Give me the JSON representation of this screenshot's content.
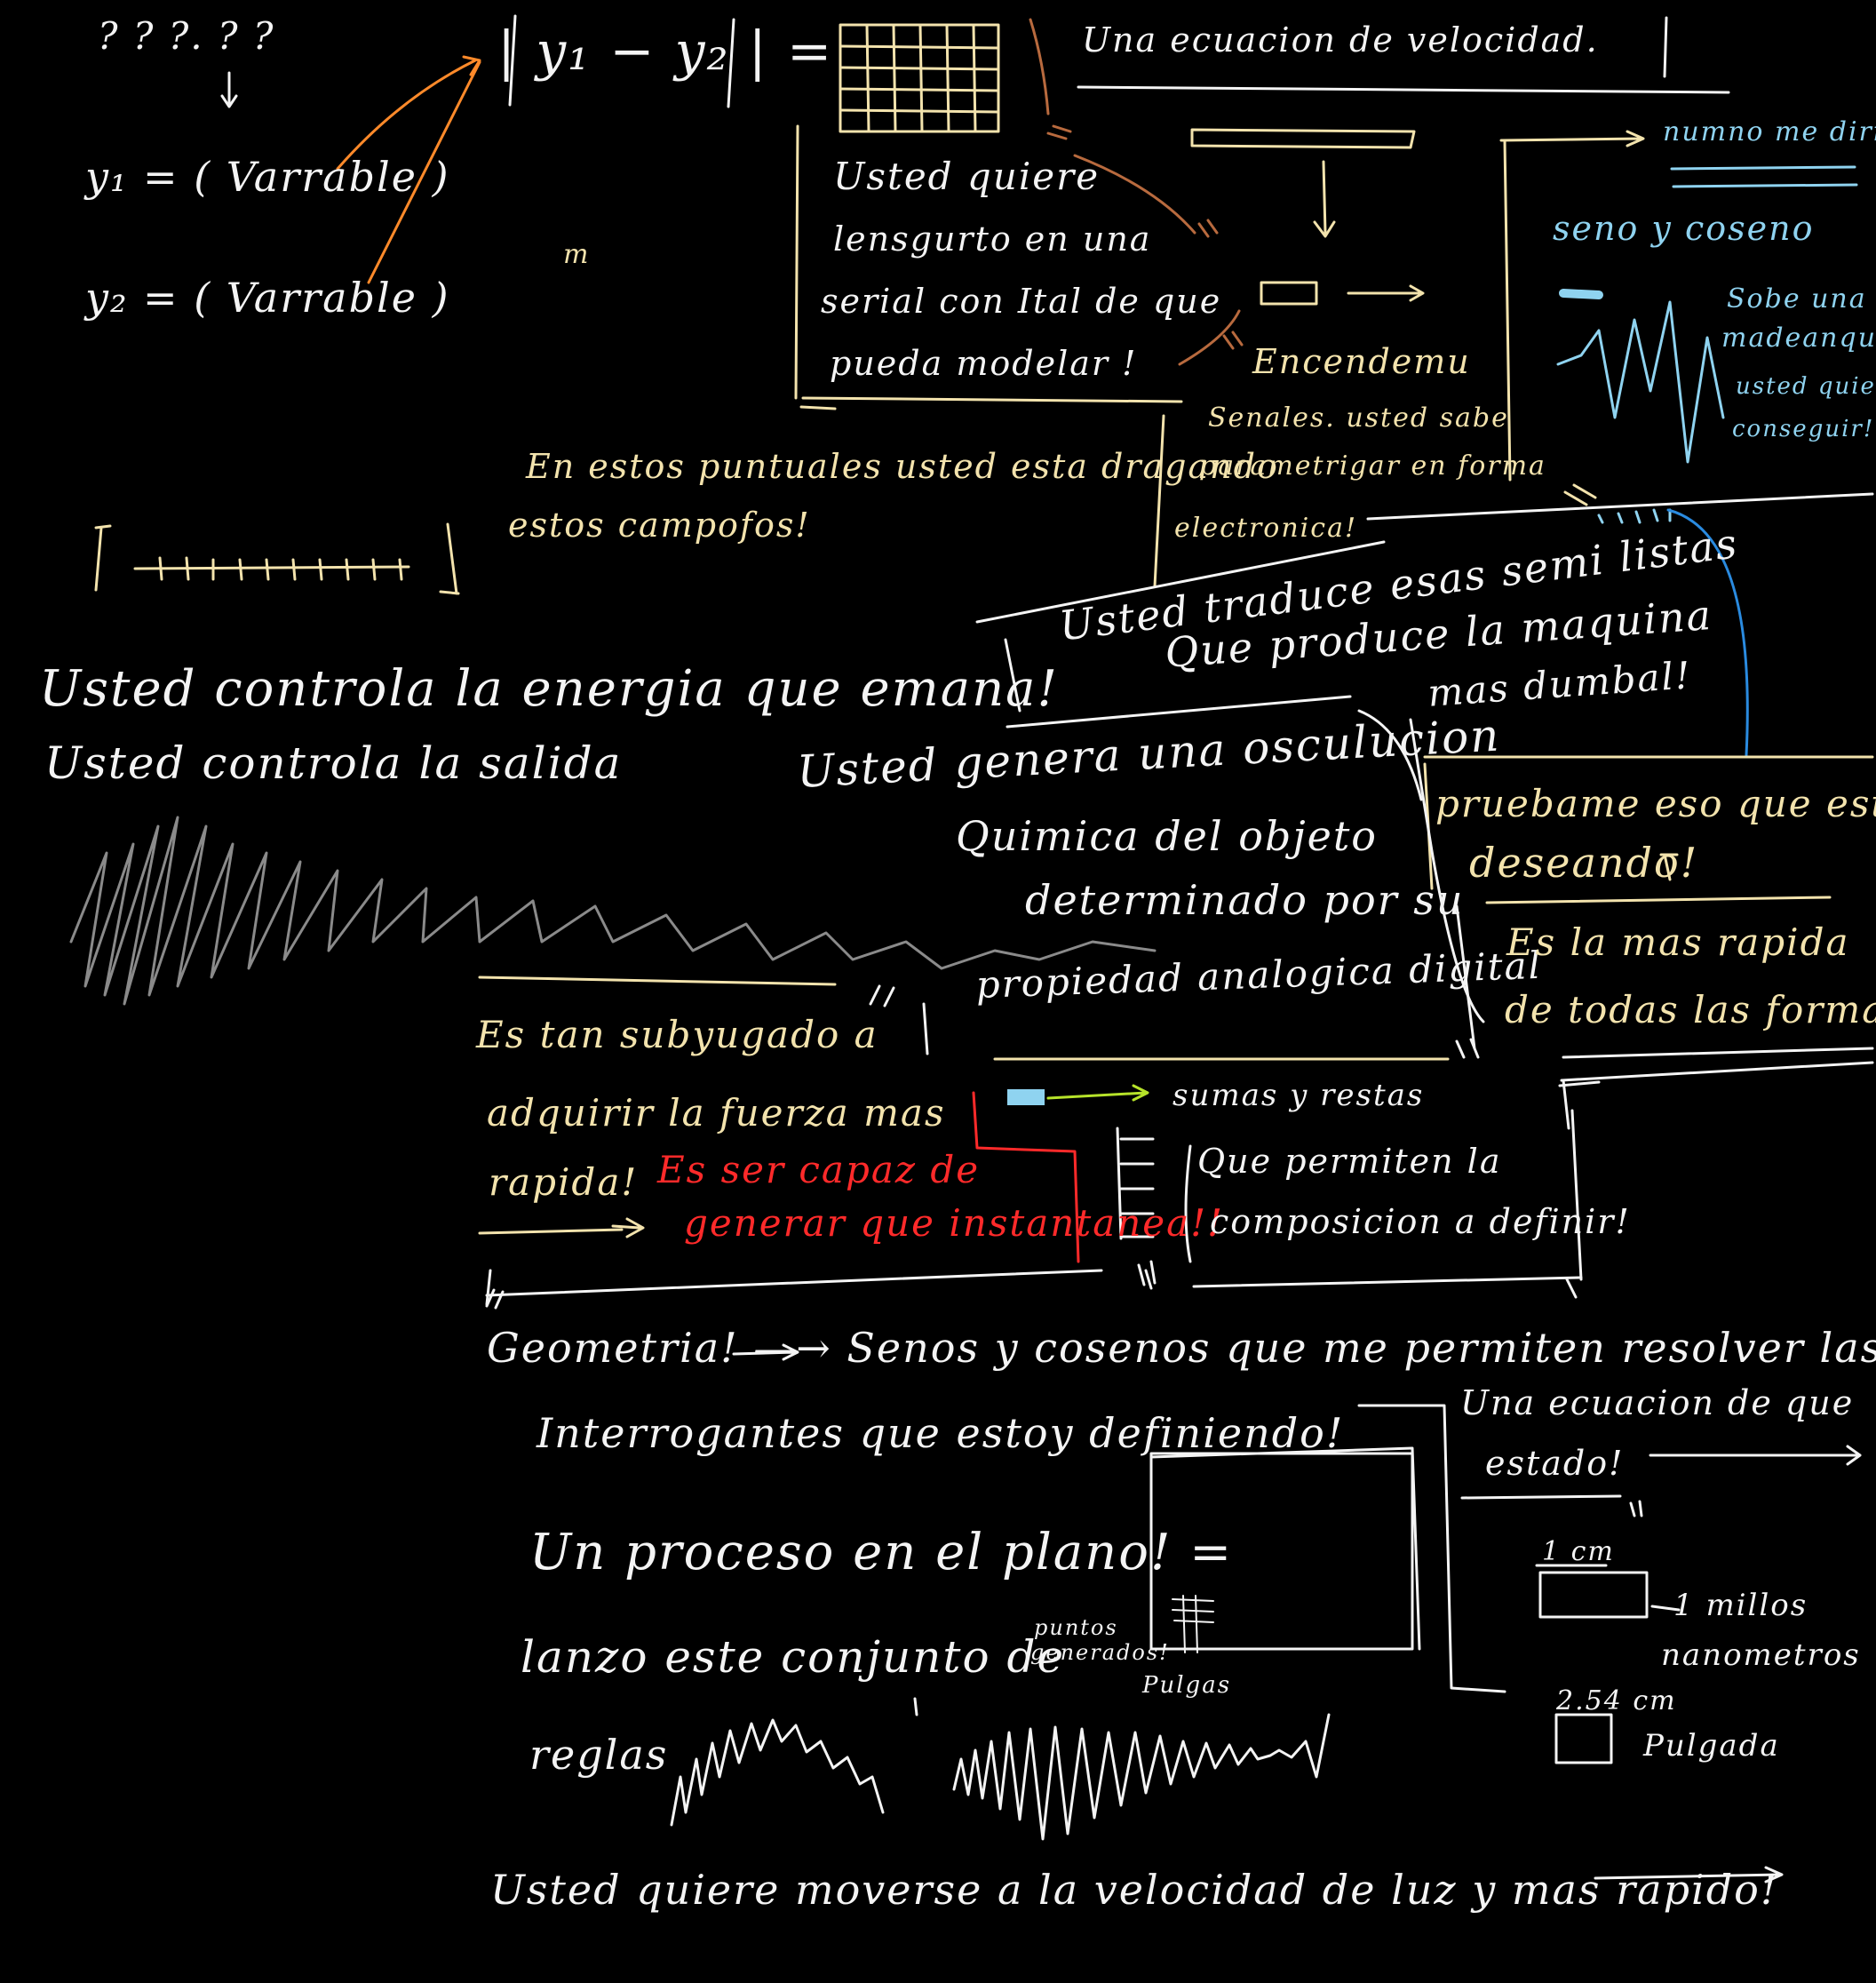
{
  "colors": {
    "background": "#000000",
    "white_ink": "#f4f4f4",
    "cream_ink": "#f3e3ad",
    "orange_ink": "#ff8a2a",
    "brown_ink": "#b86a3e",
    "blue_ink": "#8fd3f0",
    "deep_blue_ink": "#2a8be0",
    "red_ink": "#ff2a2a",
    "green_ink": "#b6e32a",
    "gray_ink": "#8a8a8a"
  },
  "top_left": {
    "question_marks": "? ? ?. ? ?",
    "y1_def": "y₁ = ( Varrable )",
    "y2_def": "y₂ = ( Varrable )",
    "stray_mark": "m"
  },
  "equation": {
    "expr": "| y₁ − y₂ | ="
  },
  "speed_title": "Una ecuacion de velocidad.",
  "box_upper": [
    "Usted quiere",
    "lensgurto en una",
    "serial con Ital de que",
    "pueda modelar !"
  ],
  "signals_panel": {
    "on_label": "Encendemu",
    "note": [
      "Senales. usted sabe",
      "parametrigar en forma",
      "electronica!"
    ]
  },
  "blue_panel": {
    "title": "numno me dirija!",
    "subtitle": "seno y coseno",
    "note": [
      "Sobe una",
      "madeanque",
      "usted quiere",
      "conseguir!"
    ]
  },
  "cream_dragging": [
    "En estos puntuales usted esta dragando",
    "estos campofos!"
  ],
  "translate_box": [
    "Usted traduce esas semi listas",
    "Que produce la maquina",
    "mas dumbal!"
  ],
  "energy_lines": [
    "Usted controla la energia que emana!",
    "Usted controla la salida"
  ],
  "oscillation": [
    "Usted genera una osculucion",
    "Quimica del objeto",
    "determinado por su",
    "propiedad analogica digital"
  ],
  "prove_box": [
    "pruebame eso que estas",
    "deseando!"
  ],
  "fastest_box": [
    "Es la mas rapida",
    "de todas las formas"
  ],
  "subjugated": {
    "lines": [
      "Es tan subyugado a",
      "adquirir la fuerza mas",
      "rapida!"
    ],
    "red": [
      "Es ser capaz de",
      "generar que instantanea!!"
    ]
  },
  "sums": {
    "label": "sumas y restas",
    "text": [
      "Que permiten la",
      "composicion a definir!"
    ]
  },
  "geometry": [
    "Geometria! —→ Senos y cosenos que me permiten resolver las",
    "Interrogantes que estoy definiendo!"
  ],
  "plane": {
    "title": "Un proceso en el plano! =",
    "launch": "lanzo este conjunto de",
    "small_note": [
      "puntos",
      "generados!"
    ],
    "pulgas": "Pulgas",
    "reglas": "reglas"
  },
  "eq_state": [
    "Una ecuacion de que",
    "estado!"
  ],
  "units": {
    "cm": "1 cm",
    "millos": "1 millos",
    "nm": "nanometros",
    "inch_num": "2.54 cm",
    "pulgada": "Pulgada"
  },
  "bottom_line": "Usted quiere moverse a la velocidad de luz y mas rapido!"
}
